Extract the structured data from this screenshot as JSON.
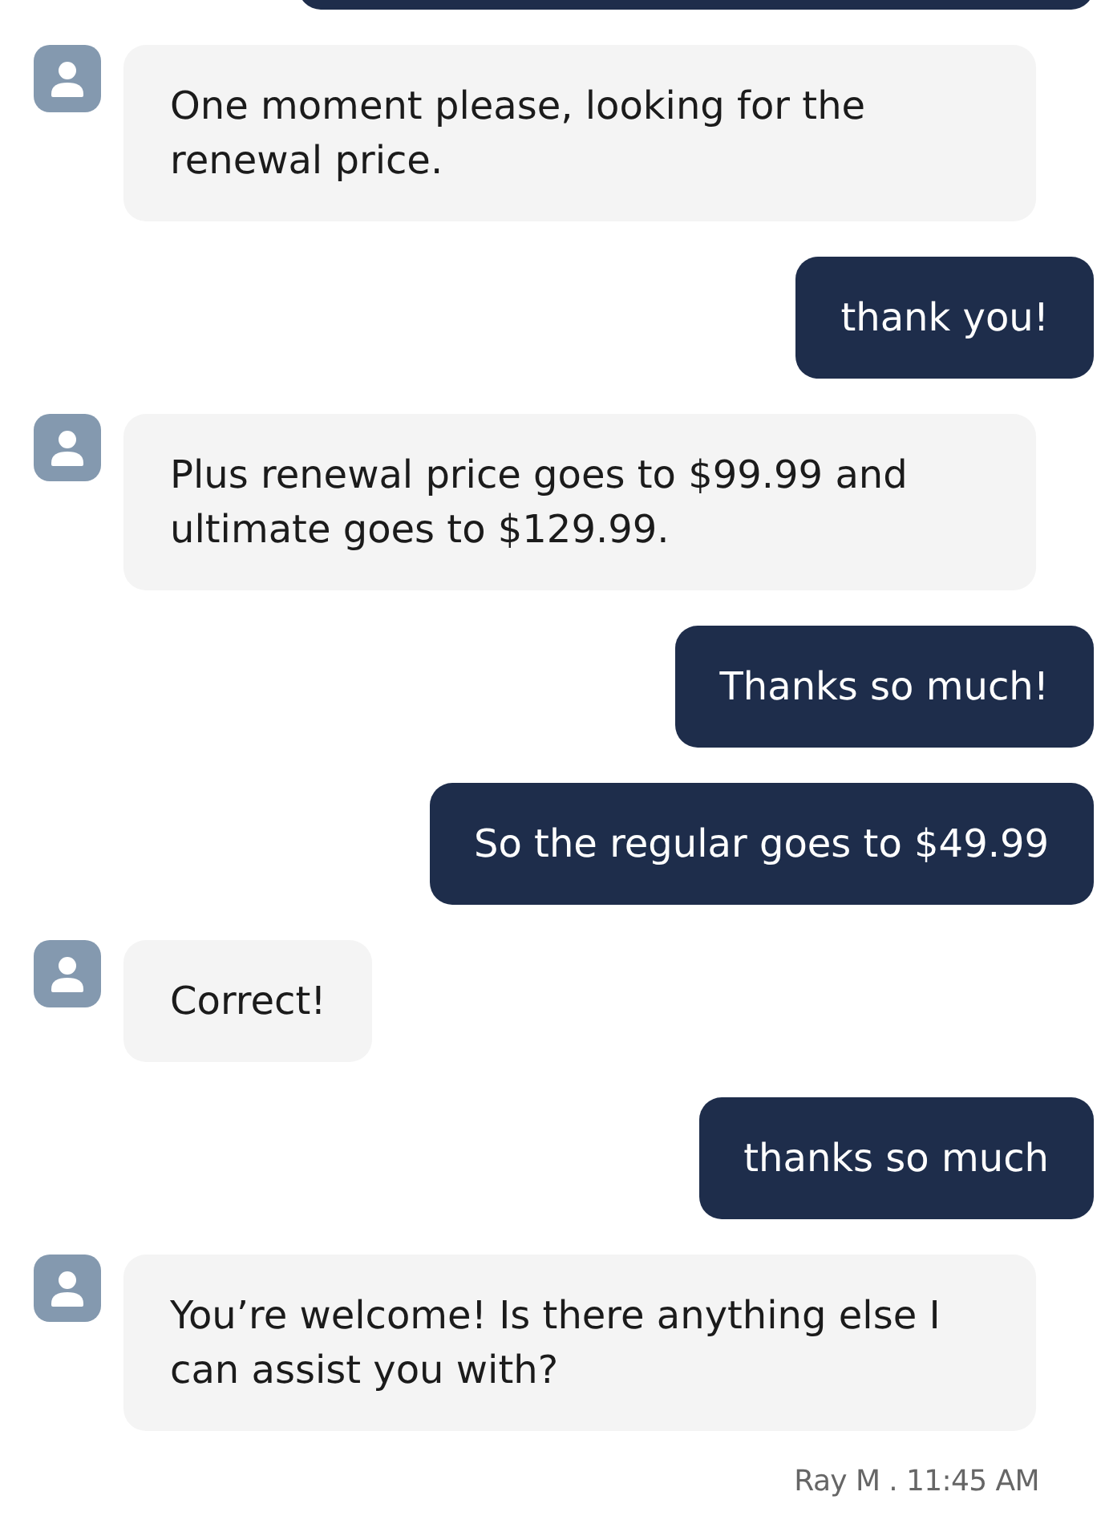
{
  "messages": [
    {
      "kind": "user",
      "cut_off": true
    },
    {
      "kind": "agent",
      "cut_off": false,
      "text": "One moment please, looking for the renewal price."
    },
    {
      "kind": "user",
      "cut_off": false,
      "text": "thank you!"
    },
    {
      "kind": "agent",
      "cut_off": false,
      "text": "Plus renewal price goes to $99.99 and ultimate goes to $129.99."
    },
    {
      "kind": "user",
      "cut_off": false,
      "text": "Thanks so much!"
    },
    {
      "kind": "user",
      "cut_off": false,
      "text": "So the regular goes to $49.99"
    },
    {
      "kind": "agent",
      "cut_off": false,
      "text": "Correct!"
    },
    {
      "kind": "user",
      "cut_off": false,
      "text": "thanks so much"
    },
    {
      "kind": "agent",
      "cut_off": false,
      "text": "You’re welcome! Is there anything else I can assist you with?"
    }
  ],
  "meta": "Ray M . 11:45 AM"
}
